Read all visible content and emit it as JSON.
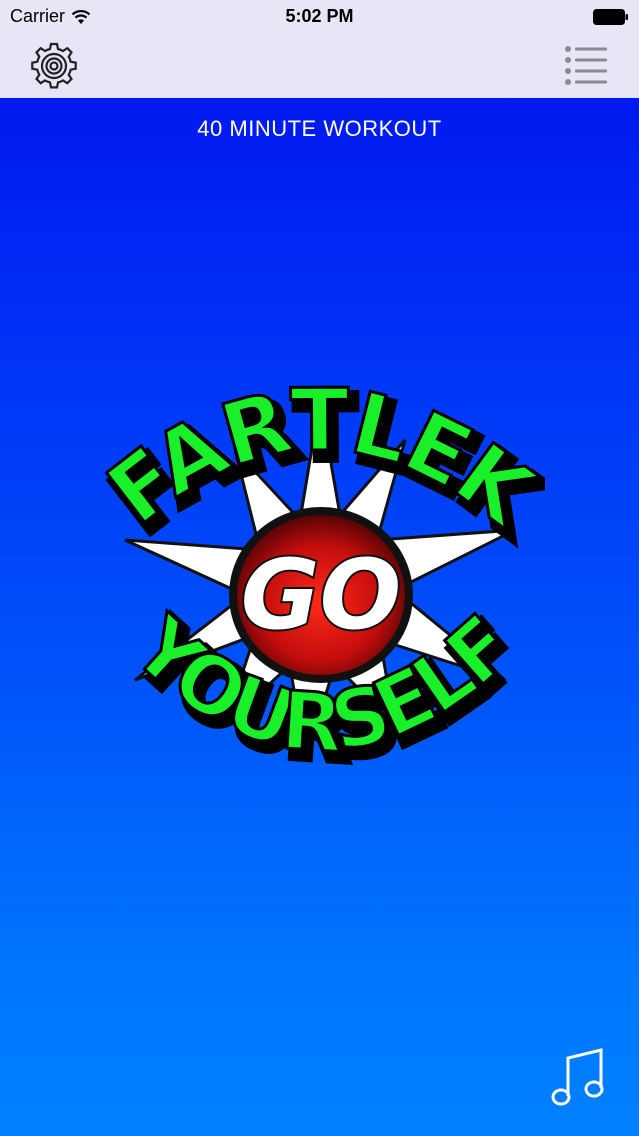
{
  "status_bar": {
    "carrier": "Carrier",
    "time": "5:02 PM",
    "icons": {
      "wifi": "wifi-icon",
      "battery": "battery-icon"
    }
  },
  "toolbar": {
    "left_icon": "gear-icon",
    "right_icon": "list-icon"
  },
  "main": {
    "title": "40 MINUTE WORKOUT",
    "logo": {
      "top_text": "FARTLEK",
      "center_text": "GO",
      "bottom_text": "YOURSELF"
    },
    "music_icon": "music-note-icon"
  },
  "colors": {
    "toolbar_bg": "#e6e6f6",
    "gradient_top": "#0019f0",
    "gradient_bottom": "#0080ff",
    "logo_green": "#19f02a",
    "logo_red": "#d61010",
    "white": "#ffffff"
  }
}
